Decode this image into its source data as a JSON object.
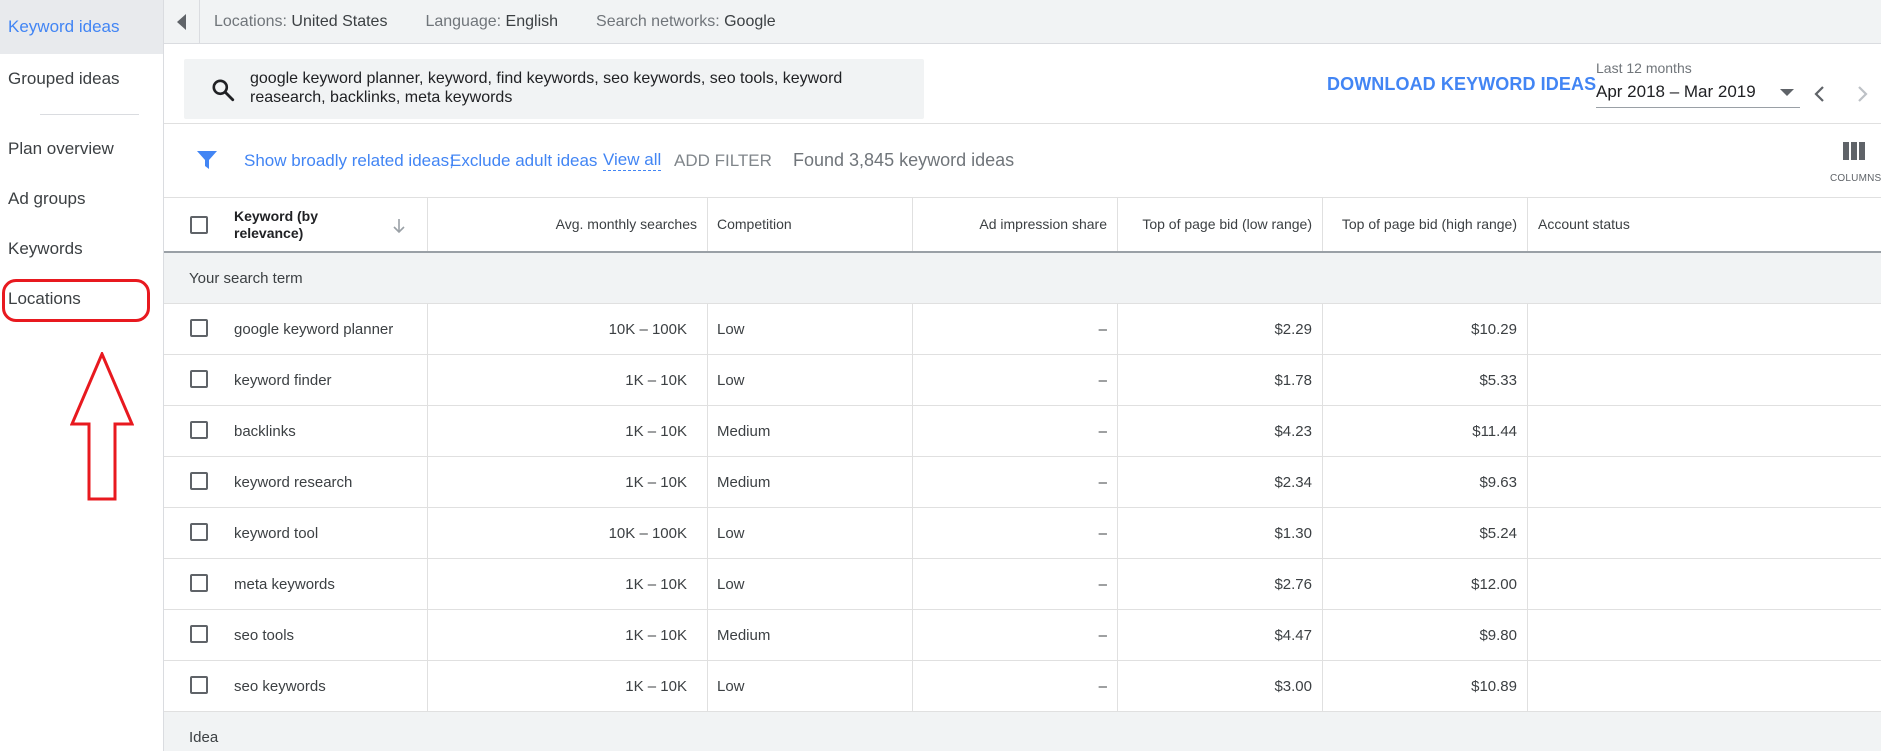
{
  "sidebar": {
    "items": [
      {
        "label": "Keyword ideas"
      },
      {
        "label": "Grouped ideas"
      },
      {
        "label": "Plan overview"
      },
      {
        "label": "Ad groups"
      },
      {
        "label": "Keywords"
      },
      {
        "label": "Locations"
      }
    ]
  },
  "topbar": {
    "locations_key": "Locations:",
    "locations_value": "United States",
    "language_key": "Language:",
    "language_value": "English",
    "networks_key": "Search networks:",
    "networks_value": "Google"
  },
  "search": {
    "value": "google keyword planner, keyword, find keywords, seo keywords, seo tools, keyword reasearch, backlinks, meta keywords",
    "download_label": "DOWNLOAD KEYWORD IDEAS",
    "date_label": "Last 12 months",
    "date_value": "Apr 2018 – Mar 2019"
  },
  "filters": {
    "broad": "Show broadly related ideas;",
    "adult": "Exclude adult ideas",
    "view_all": "View all",
    "add_filter": "ADD FILTER",
    "found": "Found 3,845 keyword ideas",
    "columns_label": "COLUMNS"
  },
  "table": {
    "headers": {
      "keyword": "Keyword (by relevance)",
      "searches": "Avg. monthly searches",
      "competition": "Competition",
      "impression": "Ad impression share",
      "bid_low": "Top of page bid (low range)",
      "bid_high": "Top of page bid (high range)",
      "status": "Account status"
    },
    "section_search": "Your search term",
    "section_idea": "Idea",
    "rows": [
      {
        "keyword": "google keyword planner",
        "searches": "10K – 100K",
        "competition": "Low",
        "impression": "–",
        "low": "$2.29",
        "high": "$10.29"
      },
      {
        "keyword": "keyword finder",
        "searches": "1K – 10K",
        "competition": "Low",
        "impression": "–",
        "low": "$1.78",
        "high": "$5.33"
      },
      {
        "keyword": "backlinks",
        "searches": "1K – 10K",
        "competition": "Medium",
        "impression": "–",
        "low": "$4.23",
        "high": "$11.44"
      },
      {
        "keyword": "keyword research",
        "searches": "1K – 10K",
        "competition": "Medium",
        "impression": "–",
        "low": "$2.34",
        "high": "$9.63"
      },
      {
        "keyword": "keyword tool",
        "searches": "10K – 100K",
        "competition": "Low",
        "impression": "–",
        "low": "$1.30",
        "high": "$5.24"
      },
      {
        "keyword": "meta keywords",
        "searches": "1K – 10K",
        "competition": "Low",
        "impression": "–",
        "low": "$2.76",
        "high": "$12.00"
      },
      {
        "keyword": "seo tools",
        "searches": "1K – 10K",
        "competition": "Medium",
        "impression": "–",
        "low": "$4.47",
        "high": "$9.80"
      },
      {
        "keyword": "seo keywords",
        "searches": "1K – 10K",
        "competition": "Low",
        "impression": "–",
        "low": "$3.00",
        "high": "$10.89"
      }
    ]
  },
  "colors": {
    "accent": "#4285f4",
    "annotation": "#e8191f"
  }
}
